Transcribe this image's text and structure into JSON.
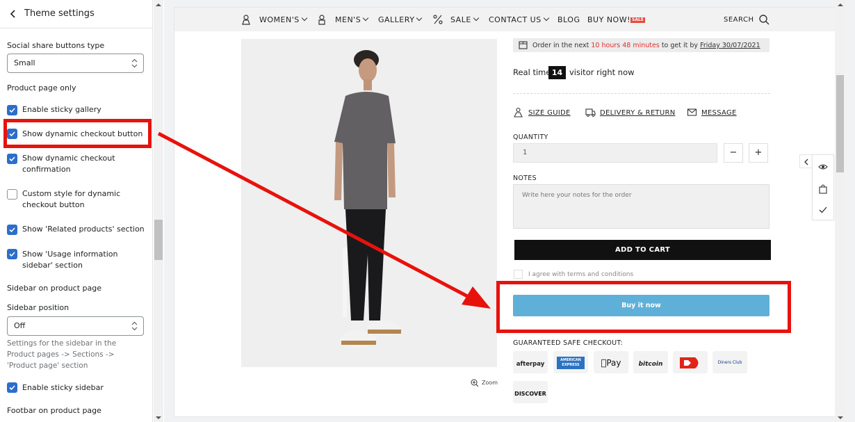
{
  "panel": {
    "title": "Theme settings",
    "social_label": "Social share buttons type",
    "social_value": "Small",
    "product_section": "Product page only",
    "checkboxes": [
      {
        "label": "Enable sticky gallery",
        "checked": true
      },
      {
        "label": "Show dynamic checkout button",
        "checked": true
      },
      {
        "label": "Show dynamic checkout confirmation",
        "checked": true
      },
      {
        "label": "Custom style for dynamic checkout button",
        "checked": false
      },
      {
        "label": "Show 'Related products' section",
        "checked": true
      },
      {
        "label": "Show 'Usage information sidebar' section",
        "checked": true
      }
    ],
    "sidebar_section": "Sidebar on product page",
    "sidebar_position_label": "Sidebar position",
    "sidebar_position_value": "Off",
    "help_text": "Settings for the sidebar in the Product pages -> Sections -> 'Product page' section",
    "sticky_sidebar": {
      "label": "Enable sticky sidebar",
      "checked": true
    },
    "footbar_section": "Footbar on product page"
  },
  "nav": {
    "items": [
      "WOMEN'S",
      "MEN'S",
      "GALLERY",
      "SALE",
      "CONTACT US",
      "BLOG",
      "BUY NOW!"
    ],
    "sale_badge": "SALE",
    "search": "SEARCH"
  },
  "product": {
    "order_prefix": "Order in the next",
    "order_time": "10 hours 48 minutes",
    "order_mid": "to get it by",
    "order_date": "Friday 30/07/2021",
    "realtime_prefix": "Real time",
    "visitor_count": "14",
    "realtime_suffix": "visitor right now",
    "links": [
      "SIZE GUIDE",
      "DELIVERY & RETURN",
      "MESSAGE"
    ],
    "quantity_label": "QUANTITY",
    "quantity_value": "1",
    "minus": "−",
    "plus": "+",
    "notes_label": "NOTES",
    "notes_placeholder": "Write here your notes for the order",
    "add_to_cart": "ADD TO CART",
    "agree": "I agree with terms and conditions",
    "buy_now": "Buy it now",
    "guaranteed": "GUARANTEED SAFE CHECKOUT:",
    "zoom": "Zoom",
    "payments": [
      "afterpay",
      "AMERICAN EXPRESS",
      "Pay",
      "bitcoin",
      "Dankort",
      "Diners Club",
      "DISCOVER"
    ]
  },
  "colors": {
    "accent": "#2c6ecb",
    "annotation": "#e8120c",
    "buy_now": "#5fb0d8",
    "sale_red": "#e23030"
  }
}
